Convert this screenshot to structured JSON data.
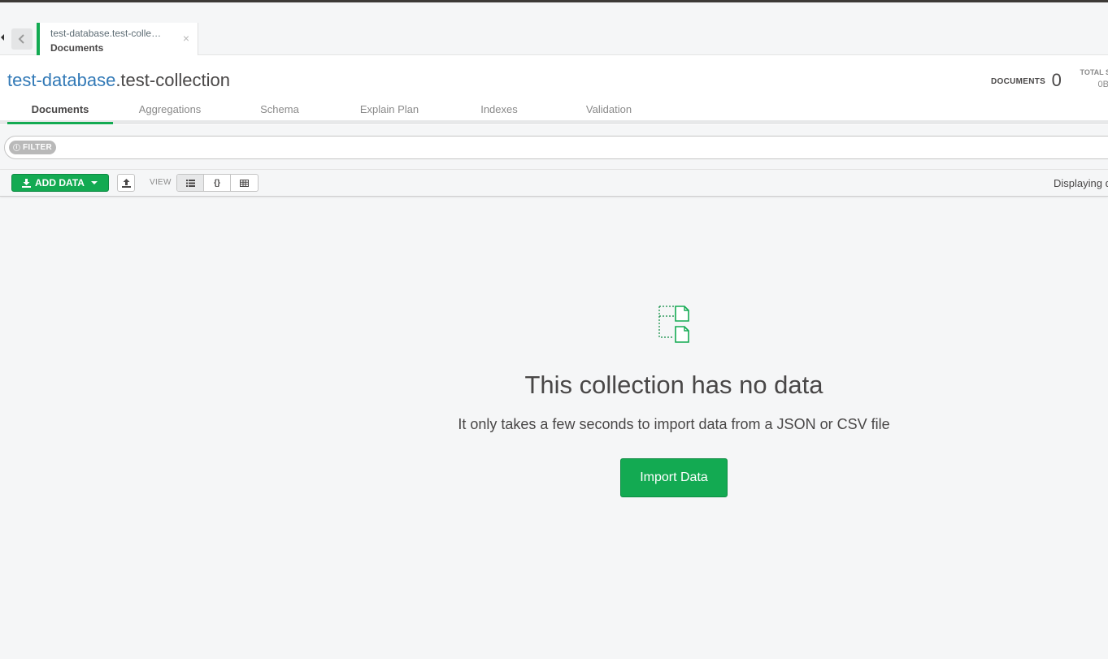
{
  "tab": {
    "namespace": "test-database.test-colle…",
    "subtitle": "Documents",
    "close_glyph": "×"
  },
  "header": {
    "database": "test-database",
    "collection": ".test-collection",
    "documents_label": "DOCUMENTS",
    "documents_count": "0",
    "total_size_label": "TOTAL SIZ",
    "total_size_value": "0B"
  },
  "subtabs": [
    {
      "label": "Documents",
      "active": true
    },
    {
      "label": "Aggregations",
      "active": false
    },
    {
      "label": "Schema",
      "active": false
    },
    {
      "label": "Explain Plan",
      "active": false
    },
    {
      "label": "Indexes",
      "active": false
    },
    {
      "label": "Validation",
      "active": false
    }
  ],
  "filter": {
    "pill_label": "FILTER"
  },
  "toolbar": {
    "add_data_label": "ADD DATA",
    "view_label": "VIEW",
    "displaying_text": "Displaying d"
  },
  "empty_state": {
    "title": "This collection has no data",
    "subtitle": "It only takes a few seconds to import data from a JSON or CSV file",
    "button_label": "Import Data"
  },
  "icons": {
    "sidebar_toggle": "caret-left-icon",
    "back": "chevron-left-icon",
    "export": "upload-icon",
    "list_view": "list-icon",
    "json_view": "braces-icon",
    "table_view": "table-icon",
    "empty": "documents-icon"
  },
  "colors": {
    "accent_green": "#13aa52",
    "link_blue": "#337ab7",
    "text": "#494747",
    "muted": "#8a8a8a"
  }
}
